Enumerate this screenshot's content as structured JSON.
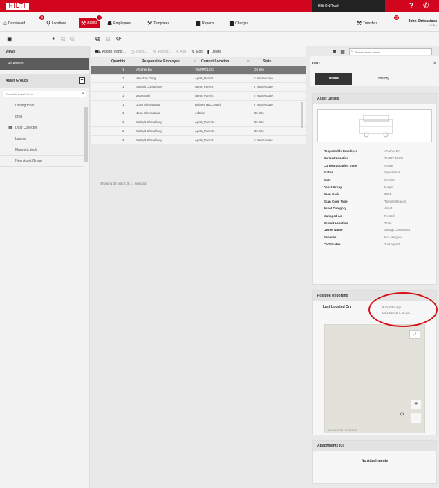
{
  "topbar": {
    "logo": "HILTI",
    "app_name": "Hilti ON!Track",
    "help_label": "?",
    "phone_icon": "phone-icon"
  },
  "nav": {
    "items": [
      {
        "label": "Dashboard",
        "icon": "home-icon",
        "badge": "4"
      },
      {
        "label": "Locations",
        "icon": "location-pin-icon"
      },
      {
        "label": "Assets",
        "icon": "assets-icon",
        "active": true
      },
      {
        "label": "Employees",
        "icon": "people-icon"
      },
      {
        "label": "Templates",
        "icon": "tools-icon"
      },
      {
        "label": "Reports",
        "icon": "report-icon"
      },
      {
        "label": "Charges",
        "icon": "charges-icon"
      }
    ],
    "transfers_label": "Transfers",
    "transfers_badge": "3",
    "user_name": "John Shrivastava",
    "user_org": "OLBA"
  },
  "sidebar": {
    "views_header": "Views",
    "views_item": "All Assets",
    "groups_header": "Asset Groups",
    "search_placeholder": "Search in Asset Group",
    "groups": [
      "Drilling tools",
      "drills",
      "Dust Collector",
      "Lasers",
      "Magnetic tools",
      "New Asset Group"
    ]
  },
  "actions": {
    "add_to_transfer": "Add to Transf...",
    "quick": "Quick...",
    "repair": "Repair...",
    "add": "Add",
    "edit": "Edit",
    "delete": "Delete",
    "search_placeholder": "Search entire assets"
  },
  "table": {
    "columns": [
      "Quantity",
      "Responsible Employee",
      "Current Location",
      "State"
    ],
    "rows": [
      {
        "qty": "1",
        "employee": "Another BA",
        "location": "TestRPOLOC",
        "state": "On Site",
        "selected": true
      },
      {
        "qty": "1",
        "employee": "Akkshay Garg",
        "location": "Apri8_Parent",
        "state": "In Warehouse"
      },
      {
        "qty": "1",
        "employee": "Satrajit Choudhury",
        "location": "Apri8_Parent",
        "state": "In Warehouse"
      },
      {
        "qty": "1",
        "employee": "asset only",
        "location": "Apri8_Parent",
        "state": "In Warehouse"
      },
      {
        "qty": "1",
        "employee": "John Shrivastava",
        "location": "Bobsev (BL27854)",
        "state": "In Warehouse"
      },
      {
        "qty": "1",
        "employee": "John Shrivastava",
        "location": "Jobsite",
        "state": "On Site"
      },
      {
        "qty": "1",
        "employee": "Satrajit Choudhury",
        "location": "Apri8_Parent1",
        "state": "On Site"
      },
      {
        "qty": "3",
        "employee": "Satrajit Choudhury",
        "location": "Apri8_Parent1",
        "state": "On Site"
      },
      {
        "qty": "1",
        "employee": "Satrajit Choudhury",
        "location": "Apri8_Parent",
        "state": "In Warehouse"
      }
    ],
    "footer": "Showing 38 out of 38 / 1 selected"
  },
  "detail": {
    "asset_id": "0001",
    "tab_details": "Details",
    "tab_history": "History",
    "asset_details_header": "Asset Details",
    "properties": [
      {
        "label": "Responsible Employee",
        "value": "Another BA"
      },
      {
        "label": "Current Location",
        "value": "TestRPOLOC"
      },
      {
        "label": "Current Location State",
        "value": "Active"
      },
      {
        "label": "Status",
        "value": "Operational"
      },
      {
        "label": "State",
        "value": "On Site"
      },
      {
        "label": "Asset Group",
        "value": "testpcf"
      },
      {
        "label": "Scan Code",
        "value": "0001"
      },
      {
        "label": "Scan Code Type",
        "value": "Trimble Beacon"
      },
      {
        "label": "Asset Category",
        "value": "Asset"
      },
      {
        "label": "Managed As",
        "value": "Rented"
      },
      {
        "label": "Default Location",
        "value": "Test1"
      },
      {
        "label": "Owner Name",
        "value": "Satrajit Choudhury"
      },
      {
        "label": "Services",
        "value": "Not assigned"
      },
      {
        "label": "Certificates",
        "value": "2 Assigned"
      }
    ],
    "position_header": "Position Reporting",
    "last_updated_label": "Last Updated On",
    "last_updated_relative": "8 months ago",
    "last_updated_date": "04/22/2018 4:25:28...",
    "map_footer": "Map data ©2018 · Terms of Use",
    "attachments_header": "Attachments (0)",
    "no_attachments": "No Attachments"
  },
  "colors": {
    "brand_red": "#d2051e",
    "selected_row": "#777777",
    "highlight": "#d61017"
  }
}
